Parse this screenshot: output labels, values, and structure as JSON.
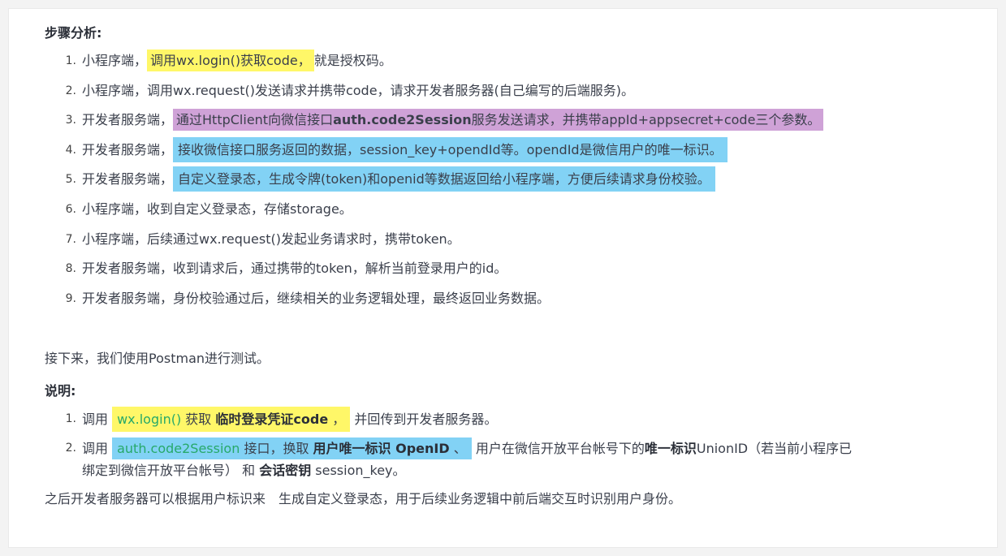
{
  "section1": {
    "heading": "步骤分析:",
    "steps": [
      {
        "num": "1.",
        "pre": "小程序端，",
        "hl": "调用wx.login()获取code，",
        "post": "就是授权码。"
      },
      {
        "num": "2.",
        "text": "小程序端，调用wx.request()发送请求并携带code，请求开发者服务器(自己编写的后端服务)。"
      },
      {
        "num": "3.",
        "pre": "开发者服务端，",
        "hl_a": "通过HttpClient向微信接口",
        "hl_bold": "auth.code2Session",
        "hl_b": "服务发送请求，并携带appId+appsecret+code三个参数。"
      },
      {
        "num": "4.",
        "pre": "开发者服务端，",
        "hl": "接收微信接口服务返回的数据，session_key+opendId等。opendId是微信用户的唯一标识。"
      },
      {
        "num": "5.",
        "pre": "开发者服务端，",
        "hl": "自定义登录态，生成令牌(token)和openid等数据返回给小程序端，方便后续请求身份校验。"
      },
      {
        "num": "6.",
        "text": "小程序端，收到自定义登录态，存储storage。"
      },
      {
        "num": "7.",
        "text": "小程序端，后续通过wx.request()发起业务请求时，携带token。"
      },
      {
        "num": "8.",
        "text": "开发者服务端，收到请求后，通过携带的token，解析当前登录用户的id。"
      },
      {
        "num": "9.",
        "text": "开发者服务端，身份校验通过后，继续相关的业务逻辑处理，最终返回业务数据。"
      }
    ]
  },
  "intro": "接下来，我们使用Postman进行测试。",
  "section2": {
    "heading": "说明:",
    "item1": {
      "num": "1.",
      "pre": "调用 ",
      "code": "wx.login()",
      "mid": " 获取 ",
      "bold": "临时登录凭证code",
      "tail_hl": " ，",
      "post": " 并回传到开发者服务器。"
    },
    "item2": {
      "num": "2.",
      "pre": "调用 ",
      "code": "auth.code2Session",
      "mid": " 接口，换取 ",
      "bold1": "用户唯一标识 OpenID",
      "sep": " 、",
      "mid2": " 用户在微信开放平台帐号下的",
      "bold2": "唯一标识",
      "mid3": "UnionID（若当前小程序已绑定到微信开放平台帐号） 和 ",
      "bold3": "会话密钥",
      "post": " session_key。"
    }
  },
  "outro": "之后开发者服务器可以根据用户标识来　生成自定义登录态，用于后续业务逻辑中前后端交互时识别用户身份。"
}
